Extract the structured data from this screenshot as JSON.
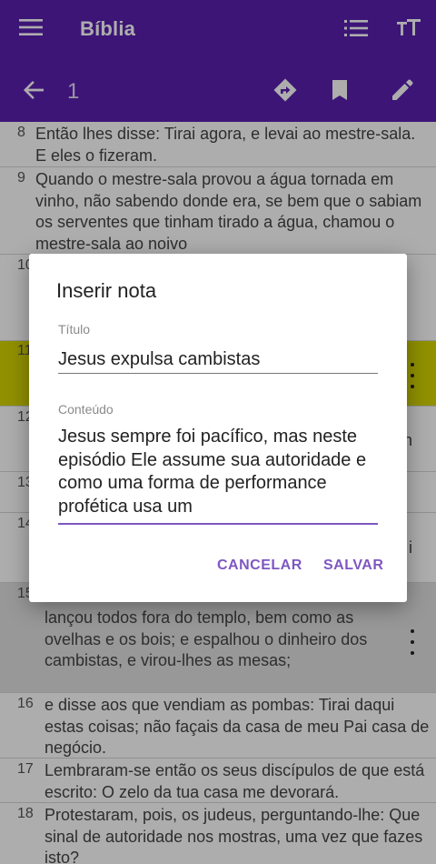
{
  "appbar": {
    "title": "Bíblia",
    "chapter": "1",
    "background": "#5b1fb0"
  },
  "icons": {
    "menu": "hamburger-menu",
    "list": "list-view",
    "text_size": "text-size",
    "back": "arrow-left",
    "go_to": "navigation-diamond-arrow",
    "bookmark": "bookmark",
    "edit": "pencil"
  },
  "verses": [
    {
      "num": "8",
      "text": "Então lhes disse: Tirai agora, e levai ao mestre-sala. E eles o fizeram."
    },
    {
      "num": "9",
      "text": "Quando o mestre-sala provou a água tornada em vinho, não sabendo donde era, se bem que o sabiam os serventes que tinham tirado a água, chamou o mestre-sala ao noivo"
    },
    {
      "num": "10",
      "text": ""
    },
    {
      "num": "11",
      "text": ""
    },
    {
      "num": "12",
      "text": "",
      "edge": "n"
    },
    {
      "num": "13",
      "text": ""
    },
    {
      "num": "14",
      "text": "",
      "edge": "i"
    },
    {
      "num": "15",
      "text": "lançou todos fora do templo, bem como as ovelhas e os bois; e espalhou o dinheiro dos cambistas, e virou-lhes as mesas;"
    },
    {
      "num": "16",
      "text": "e disse aos que vendiam as pombas: Tirai daqui estas coisas; não façais da casa de meu Pai casa de negócio."
    },
    {
      "num": "17",
      "text": "Lembraram-se então os seus discípulos de que está escrito: O zelo da tua casa me devorará."
    },
    {
      "num": "18",
      "text": "Protestaram, pois, os judeus, perguntando-lhe: Que sinal de autoridade nos mostras, uma vez que fazes isto?"
    }
  ],
  "highlight_color": "#d4d400",
  "dialog": {
    "title": "Inserir nota",
    "title_label": "Título",
    "title_value": "Jesus expulsa cambistas",
    "content_label": "Conteúdo",
    "content_value": "Jesus sempre foi pacífico, mas neste episódio Ele assume sua autoridade e como uma forma de performance profética usa um",
    "cancel_label": "CANCELAR",
    "save_label": "SALVAR",
    "accent_color": "#7e57c2"
  }
}
